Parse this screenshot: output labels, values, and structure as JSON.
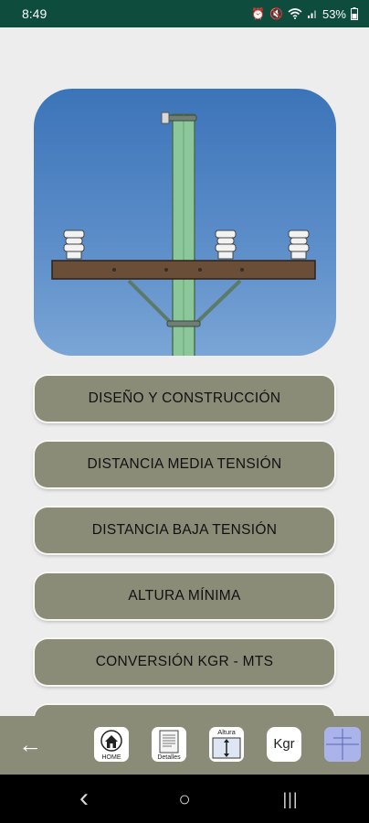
{
  "status_bar": {
    "time": "8:49",
    "battery": "53%",
    "icons": [
      "alarm-icon",
      "mute-icon",
      "wifi-icon",
      "signal-icon",
      "battery-icon"
    ]
  },
  "hero": {
    "image": "utility-pole-illustration",
    "colors": {
      "sky": "#4a7fc1",
      "pole": "#8cc79a",
      "crossarm": "#6b4e37"
    }
  },
  "menu": {
    "items": [
      {
        "label": "DISEÑO Y CONSTRUCCIÓN"
      },
      {
        "label": "DISTANCIA MEDIA TENSIÓN"
      },
      {
        "label": "DISTANCIA BAJA TENSIÓN"
      },
      {
        "label": "ALTURA MÍNIMA"
      },
      {
        "label": "CONVERSIÓN KGR - MTS"
      },
      {
        "label": ""
      }
    ],
    "button_color": "#8a8c78"
  },
  "app_bar": {
    "back_icon": "back-arrow-icon",
    "items": [
      {
        "name": "home",
        "label": "HOME"
      },
      {
        "name": "detalles",
        "label": "Detalles"
      },
      {
        "name": "altura",
        "label": "Altura"
      },
      {
        "name": "kgr",
        "label": "Kgr"
      },
      {
        "name": "grid",
        "label": ""
      }
    ]
  },
  "system_nav": {
    "back": "‹",
    "home": "○",
    "recents": "|||"
  }
}
